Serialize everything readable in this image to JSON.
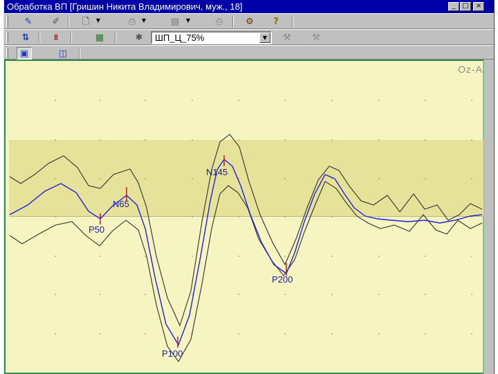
{
  "window": {
    "title": "Обработка ВП [Гришин Никита Владимирович, муж., 18]",
    "controls": [
      "_",
      "□",
      "×"
    ]
  },
  "toolbar2": {
    "filter_combo": {
      "value": "ШП_Ц_75%"
    }
  },
  "plot": {
    "channel": "Oz-A",
    "colors": {
      "background": "#f6f4c0",
      "band": "#e6e29a",
      "mean_curve": "#2020d8",
      "envelope": "#303030",
      "marker": "#b22222"
    },
    "peaks": [
      {
        "label": "P50"
      },
      {
        "label": "N65"
      },
      {
        "label": "P100"
      },
      {
        "label": "N145"
      },
      {
        "label": "P200"
      }
    ]
  },
  "icons": [
    "edit-icon",
    "edit2-icon",
    "new-file-icon",
    "print-icon",
    "save-icon",
    "printer-icon",
    "settings-icon",
    "help-icon",
    "filter-icon",
    "filter2-icon",
    "average-icon",
    "star-icon",
    "tool-a-icon",
    "tool-b-icon",
    "view-icon",
    "window-icon"
  ]
}
